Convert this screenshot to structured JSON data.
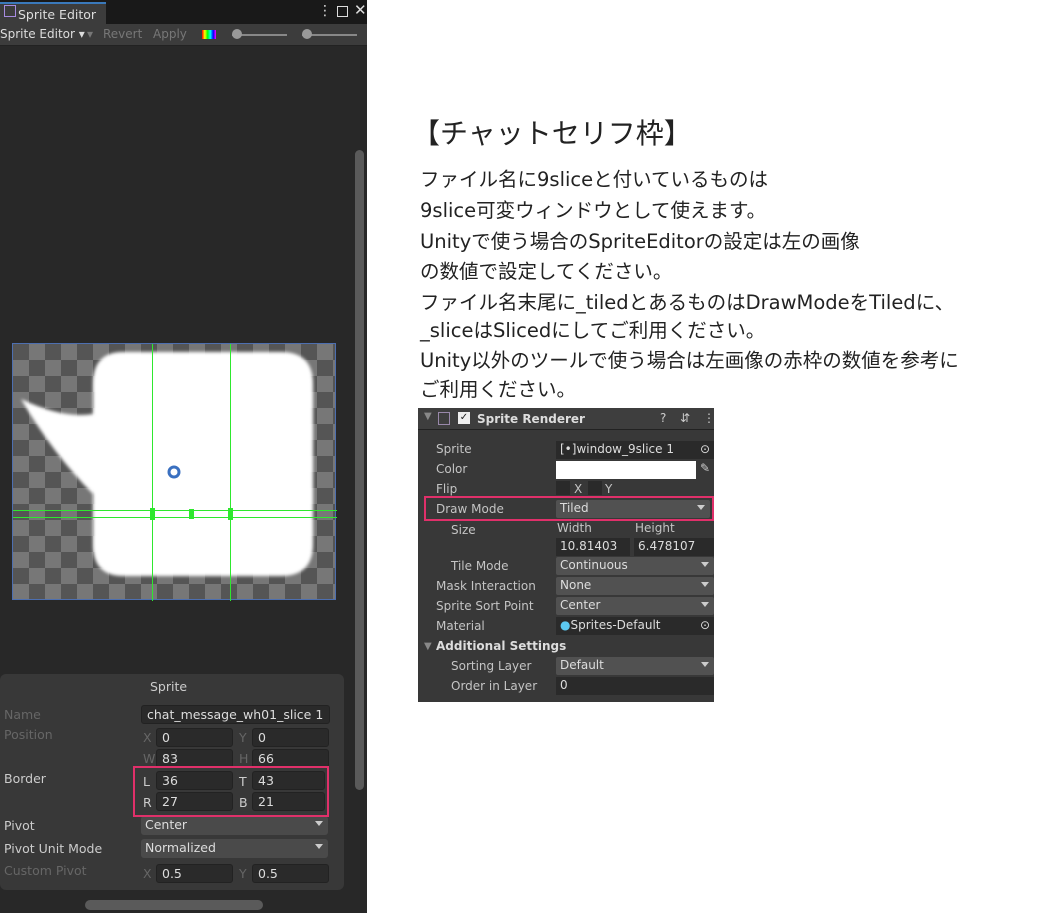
{
  "editor": {
    "tab_title": "Sprite Editor",
    "mode_dropdown": "Sprite Editor",
    "revert": "Revert",
    "apply": "Apply",
    "sprite_panel": {
      "title": "Sprite",
      "name_label": "Name",
      "name_value": "chat_message_wh01_slice 1",
      "position_label": "Position",
      "x_label": "X",
      "x": "0",
      "y_label": "Y",
      "y": "0",
      "w_label": "W",
      "w": "83",
      "h_label": "H",
      "h": "66",
      "border_label": "Border",
      "l_label": "L",
      "l": "36",
      "t_label": "T",
      "t": "43",
      "r_label": "R",
      "r": "27",
      "b_label": "B",
      "b": "21",
      "pivot_label": "Pivot",
      "pivot": "Center",
      "pivot_unit_label": "Pivot Unit Mode",
      "pivot_unit": "Normalized",
      "custom_pivot_label": "Custom Pivot",
      "cx_label": "X",
      "cx": "0.5",
      "cy_label": "Y",
      "cy": "0.5"
    }
  },
  "article": {
    "title": "【チャットセリフ枠】",
    "lines": [
      "ファイル名に9sliceと付いているものは",
      "9slice可変ウィンドウとして使えます。",
      "Unityで使う場合のSpriteEditorの設定は左の画像",
      "の数値で設定してください。",
      "ファイル名末尾に_tiledとあるものはDrawModeをTiledに、",
      "_sliceはSlicedにしてご利用ください。",
      "Unity以外のツールで使う場合は左画像の赤枠の数値を参考に",
      "ご利用ください。"
    ]
  },
  "inspector": {
    "component": "Sprite Renderer",
    "sprite_label": "Sprite",
    "sprite": "window_9slice 1",
    "color_label": "Color",
    "flip_label": "Flip",
    "flip_x": "X",
    "flip_y": "Y",
    "draw_mode_label": "Draw Mode",
    "draw_mode": "Tiled",
    "size_label": "Size",
    "width_label": "Width",
    "height_label": "Height",
    "width": "10.81403",
    "height": "6.478107",
    "tile_mode_label": "Tile Mode",
    "tile_mode": "Continuous",
    "mask_label": "Mask Interaction",
    "mask": "None",
    "sort_point_label": "Sprite Sort Point",
    "sort_point": "Center",
    "material_label": "Material",
    "material": "Sprites-Default",
    "additional": "Additional Settings",
    "sorting_layer_label": "Sorting Layer",
    "sorting_layer": "Default",
    "order_label": "Order in Layer",
    "order": "0"
  },
  "colors": {
    "highlight": "#e0306a",
    "slice_lines": "#2ee82e"
  }
}
